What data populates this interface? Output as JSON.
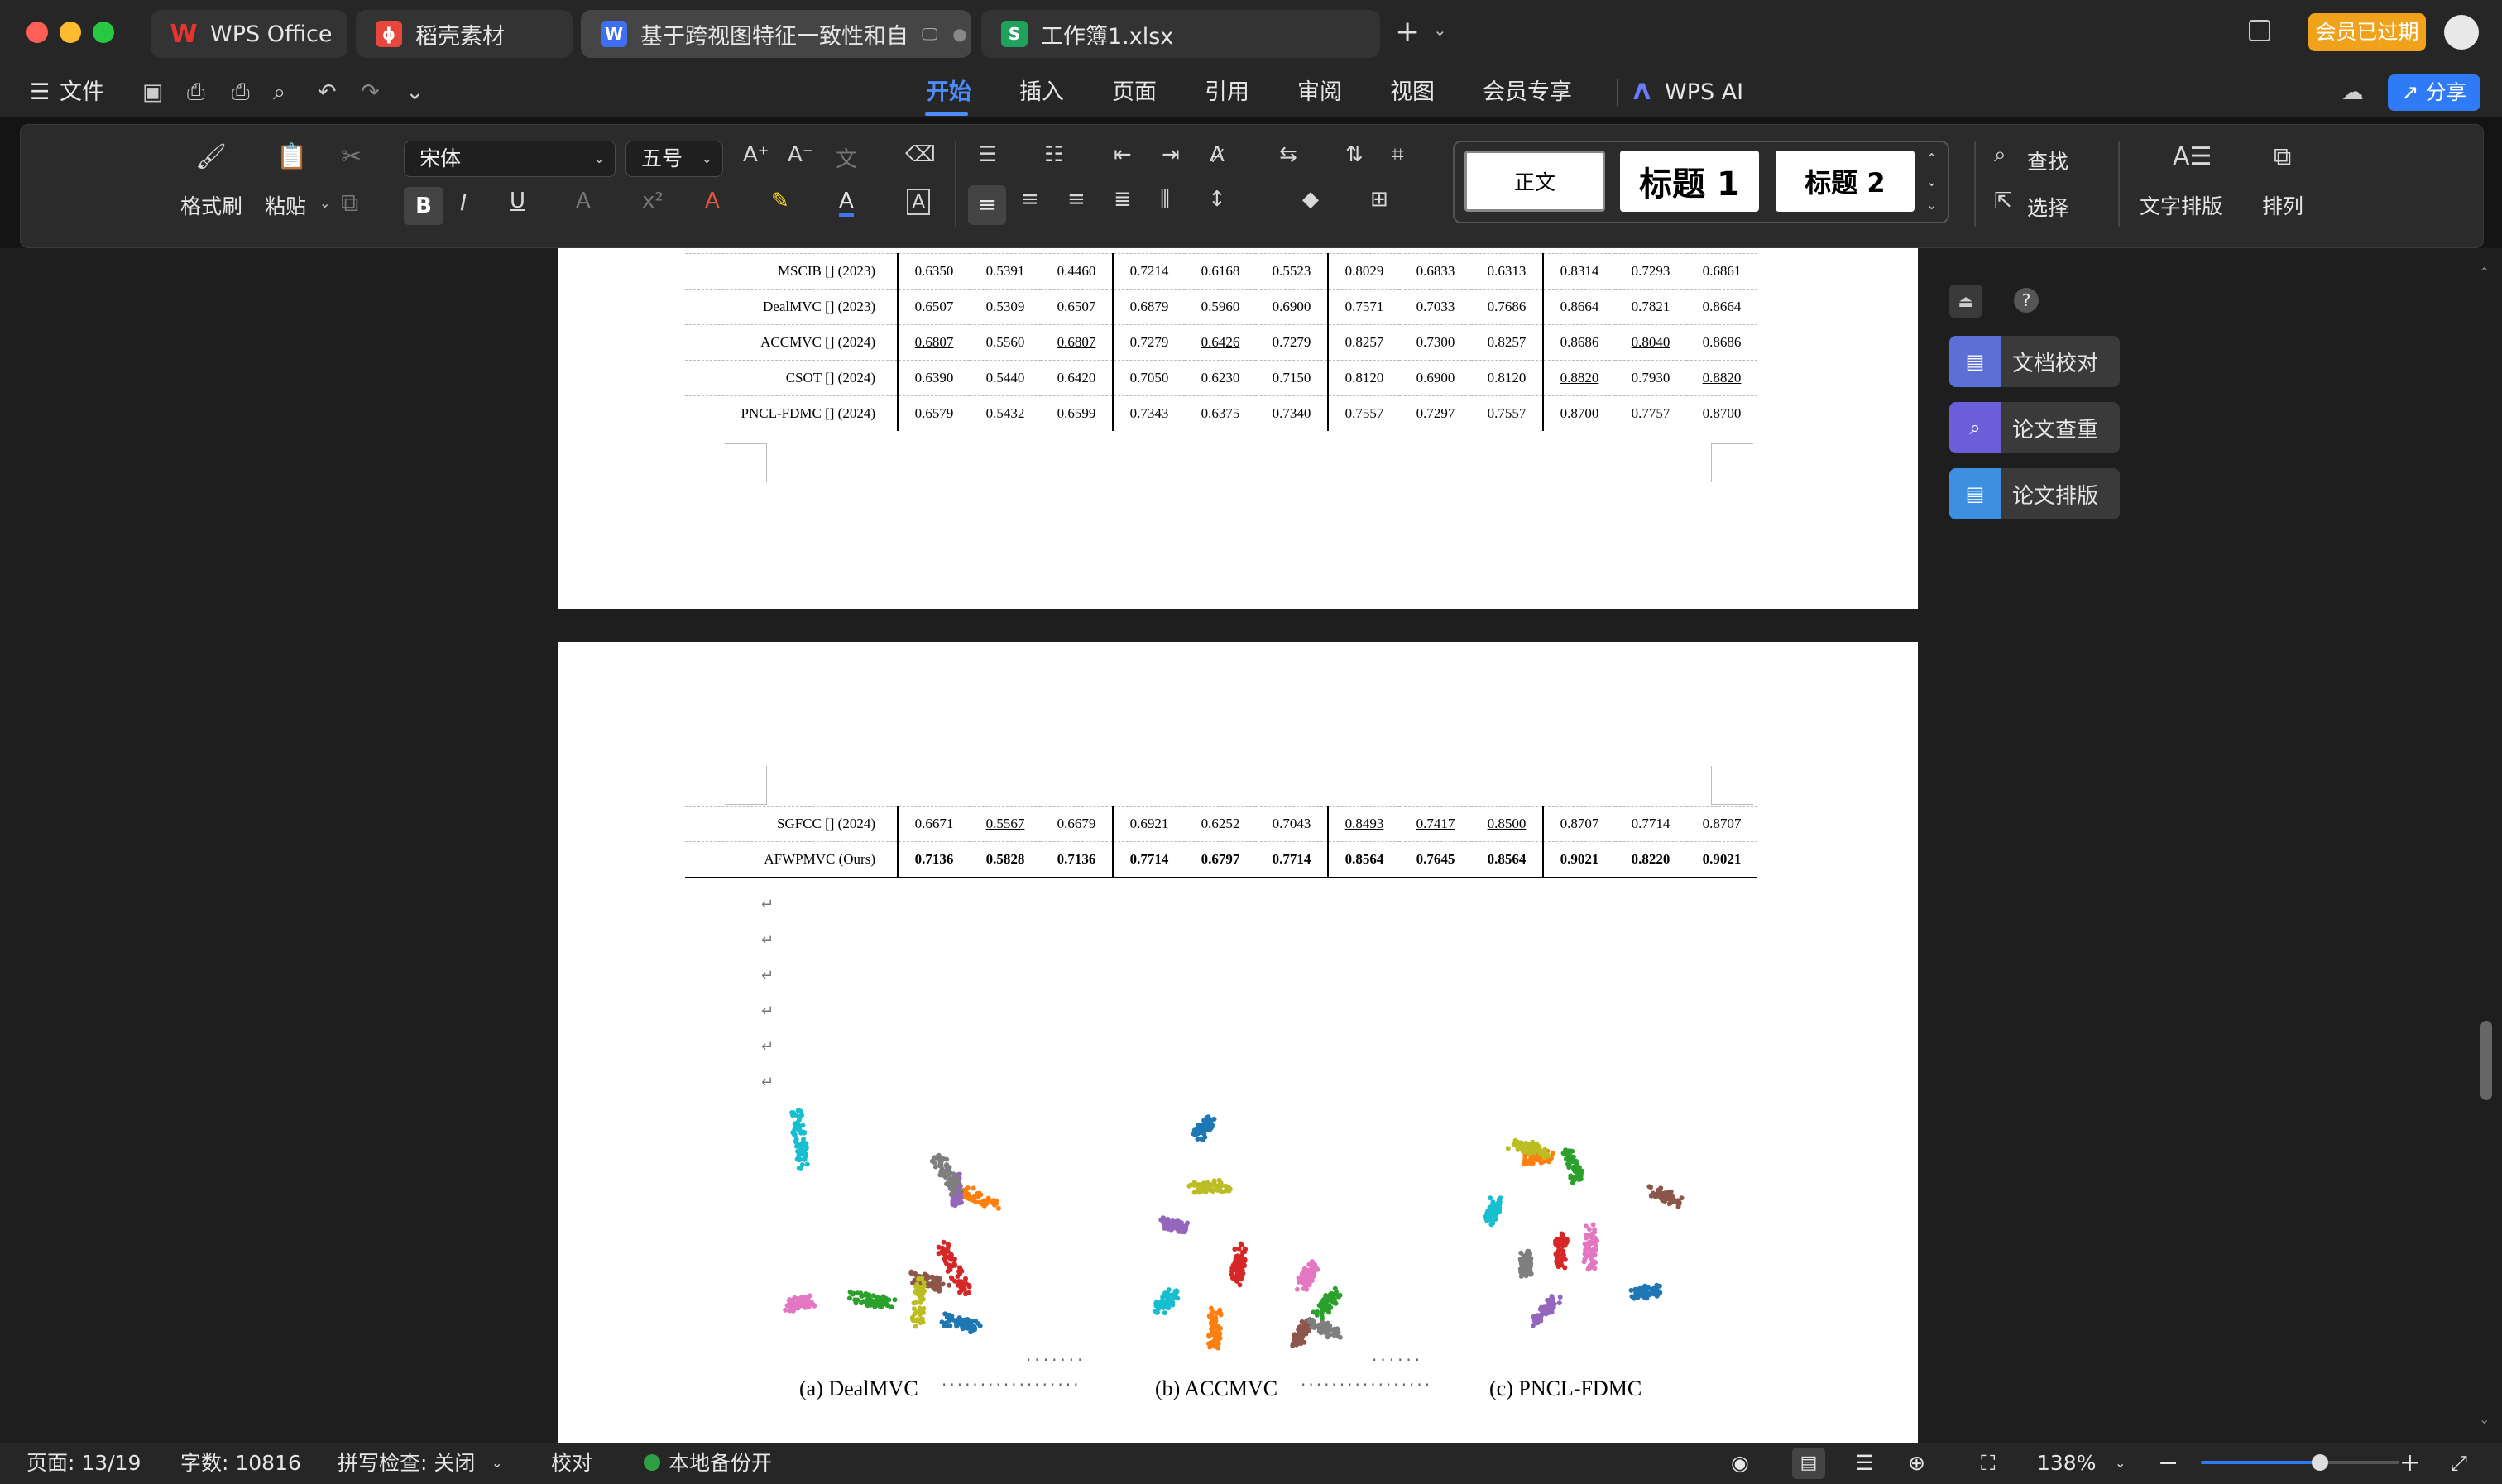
{
  "window": {
    "tabs": [
      {
        "label": "WPS Office"
      },
      {
        "label": "稻壳素材"
      },
      {
        "label": "基于跨视图特征一致性和自"
      },
      {
        "label": "工作簿1.xlsx"
      }
    ],
    "member_label": "会员已过期"
  },
  "menubar": {
    "file_label": "文件",
    "tabs": [
      "开始",
      "插入",
      "页面",
      "引用",
      "审阅",
      "视图",
      "会员专享"
    ],
    "active_tab": "开始",
    "ai_label": "WPS AI",
    "share_label": "分享"
  },
  "ribbon": {
    "format_painter": "格式刷",
    "paste": "粘贴",
    "font_name": "宋体",
    "font_size": "五号",
    "styles": [
      "正文",
      "标题 1",
      "标题 2"
    ],
    "find": "查找",
    "select": "选择",
    "text_layout": "文字排版",
    "arrange": "排列",
    "accent_color": "#2f7bf6"
  },
  "side_panel": {
    "buttons": [
      "文档校对",
      "论文查重",
      "论文排版"
    ]
  },
  "document": {
    "rows_page1": [
      {
        "name": "MSCIB [] (2023)",
        "cells": [
          "0.6350",
          "0.5391",
          "0.4460",
          "0.7214",
          "0.6168",
          "0.5523",
          "0.8029",
          "0.6833",
          "0.6313",
          "0.8314",
          "0.7293",
          "0.6861"
        ],
        "u": []
      },
      {
        "name": "DealMVC [] (2023)",
        "cells": [
          "0.6507",
          "0.5309",
          "0.6507",
          "0.6879",
          "0.5960",
          "0.6900",
          "0.7571",
          "0.7033",
          "0.7686",
          "0.8664",
          "0.7821",
          "0.8664"
        ],
        "u": []
      },
      {
        "name": "ACCMVC [] (2024)",
        "cells": [
          "0.6807",
          "0.5560",
          "0.6807",
          "0.7279",
          "0.6426",
          "0.7279",
          "0.8257",
          "0.7300",
          "0.8257",
          "0.8686",
          "0.8040",
          "0.8686"
        ],
        "u": [
          0,
          2,
          4,
          10
        ]
      },
      {
        "name": "CSOT [] (2024)",
        "cells": [
          "0.6390",
          "0.5440",
          "0.6420",
          "0.7050",
          "0.6230",
          "0.7150",
          "0.8120",
          "0.6900",
          "0.8120",
          "0.8820",
          "0.7930",
          "0.8820"
        ],
        "u": [
          9,
          11
        ]
      },
      {
        "name": "PNCL-FDMC [] (2024)",
        "cells": [
          "0.6579",
          "0.5432",
          "0.6599",
          "0.7343",
          "0.6375",
          "0.7340",
          "0.7557",
          "0.7297",
          "0.7557",
          "0.8700",
          "0.7757",
          "0.8700"
        ],
        "u": [
          3,
          5
        ]
      }
    ],
    "rows_page2": [
      {
        "name": "SGFCC [] (2024)",
        "cells": [
          "0.6671",
          "0.5567",
          "0.6679",
          "0.6921",
          "0.6252",
          "0.7043",
          "0.8493",
          "0.7417",
          "0.8500",
          "0.8707",
          "0.7714",
          "0.8707"
        ],
        "u": [
          1,
          6,
          7,
          8
        ],
        "bold": false
      },
      {
        "name": "AFWPMVC (Ours)",
        "cells": [
          "0.7136",
          "0.5828",
          "0.7136",
          "0.7714",
          "0.6797",
          "0.7714",
          "0.8564",
          "0.7645",
          "0.8564",
          "0.9021",
          "0.8220",
          "0.9021"
        ],
        "u": [],
        "bold": true
      }
    ],
    "captions": [
      "(a) DealMVC",
      "(b) ACCMVC",
      "(c) PNCL-FDMC"
    ],
    "cluster_colors": [
      "#1f77b4",
      "#ff7f0e",
      "#2ca02c",
      "#d62728",
      "#9467bd",
      "#8c564b",
      "#e377c2",
      "#7f7f7f",
      "#bcbd22",
      "#17becf"
    ]
  },
  "status": {
    "page": "页面: 13/19",
    "words": "字数: 10816",
    "spell": "拼写检查: 关闭",
    "proof": "校对",
    "backup": "本地备份开",
    "zoom": "138%",
    "zoom_level": 0.6
  }
}
